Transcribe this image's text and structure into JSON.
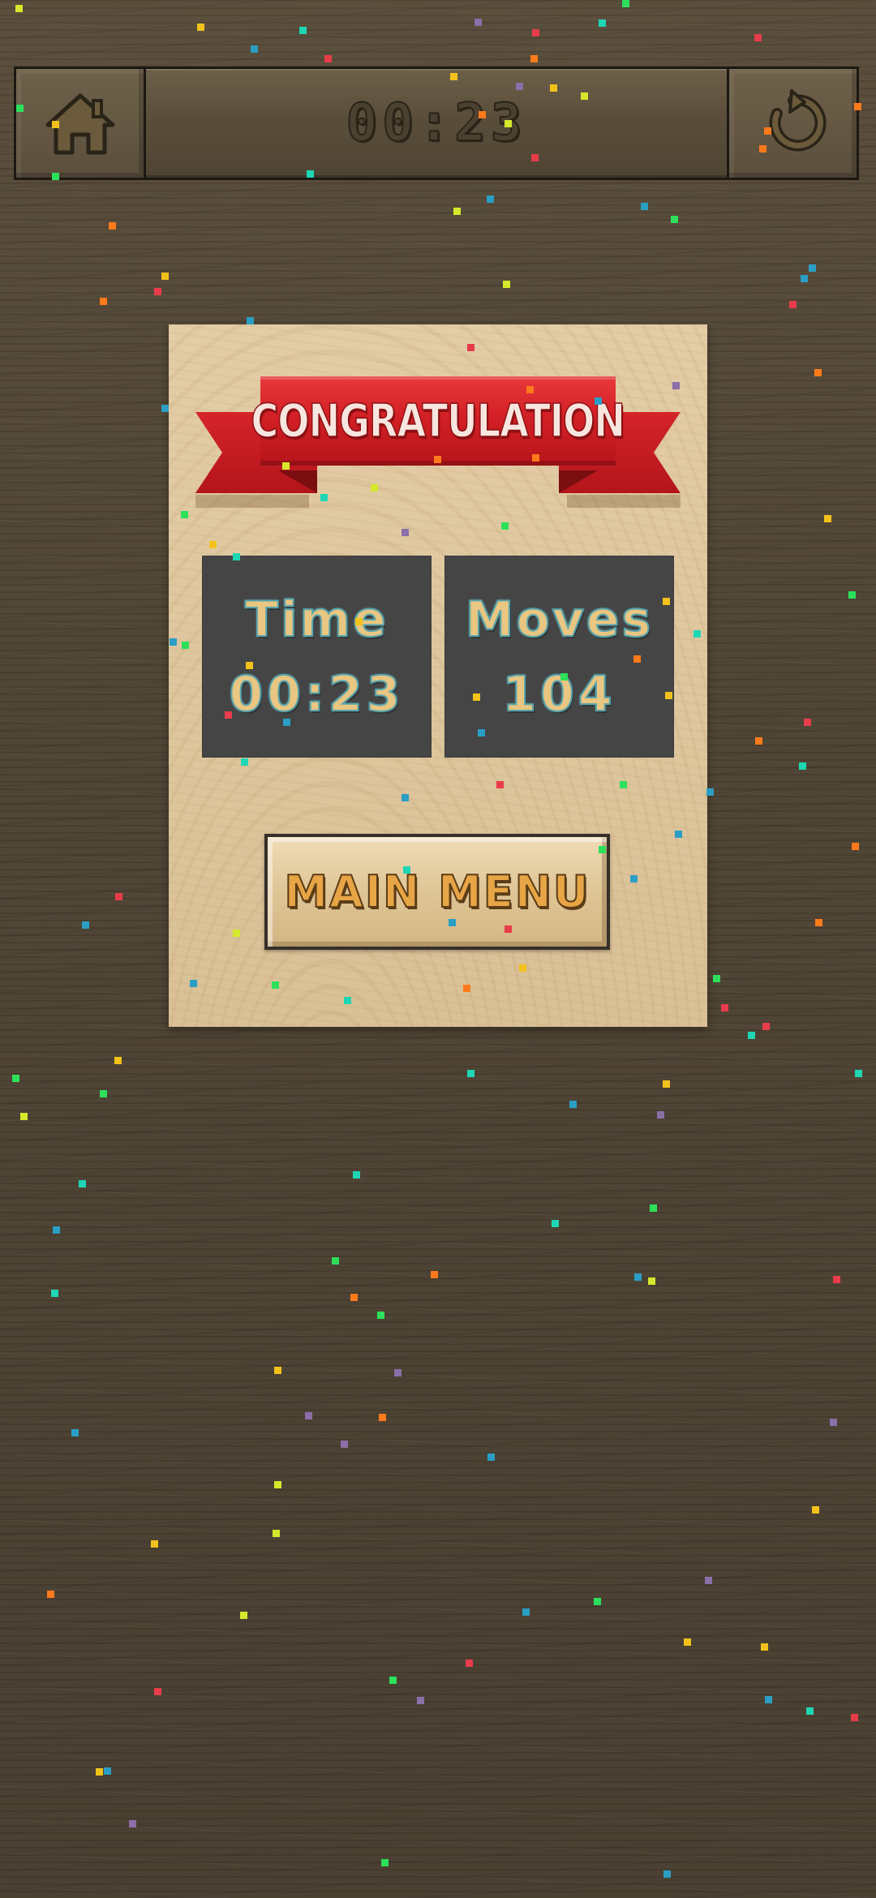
{
  "header": {
    "timer": "00:23",
    "home_icon": "home-icon",
    "restart_icon": "restart-icon"
  },
  "dialog": {
    "banner": "CONGRATULATION",
    "time": {
      "label": "Time",
      "value": "00:23"
    },
    "moves": {
      "label": "Moves",
      "value": "104"
    },
    "main_menu_label": "MAIN MENU"
  },
  "colors": {
    "background_wood": "#4e4333",
    "panel_wood": "#dcc49b",
    "ribbon_red": "#d32026",
    "stat_box": "#454545",
    "stat_text": "#e9c681",
    "stat_outline": "#5aa5ad",
    "button_text": "#e7a546",
    "confetti": [
      "#2de05a",
      "#ff7a1a",
      "#e83c4a",
      "#d6e82c",
      "#1fd6b4",
      "#8a6fa8",
      "#2a9ec4",
      "#f2c21b"
    ]
  }
}
